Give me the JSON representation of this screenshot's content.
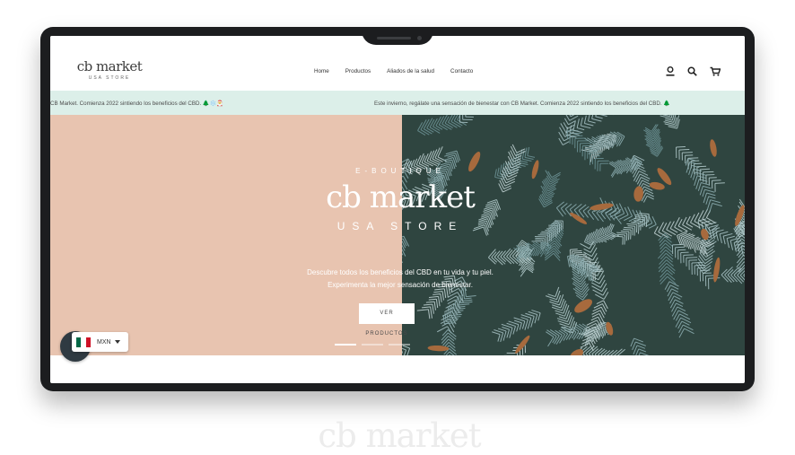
{
  "brand": {
    "name": "cb market",
    "sub": "USA STORE"
  },
  "nav": [
    "Home",
    "Productos",
    "Aliados de la salud",
    "Contacto"
  ],
  "icons": [
    "user-icon",
    "search-icon",
    "cart-icon"
  ],
  "ticker": {
    "left": "CB Market. Comienza 2022 sintiendo los beneficios del CBD. 🌲❄️🎅",
    "right": "Este invierno, regálate una sensación de bienestar con CB Market. Comienza 2022 sintiendo los beneficios del CBD. 🌲"
  },
  "hero": {
    "eyebrow": "E-BOUTIQUE",
    "title": "cb market",
    "subtitle": "USA STORE",
    "line1": "Descubre todos los beneficios del CBD en tu vida y tu piel.",
    "line2": "Experimenta la mejor sensación de bienestar.",
    "cta": "VER PRODUCTOS",
    "slides": 3,
    "active_slide": 1
  },
  "currency": {
    "code": "MXN"
  },
  "footer_logo": "cb market",
  "colors": {
    "device": "#1c1d1f",
    "ticker_bg": "#dcefe9",
    "hero_left": "#e8c4b0",
    "foliage": "#2f4540",
    "leaf": "#a76a3d"
  }
}
